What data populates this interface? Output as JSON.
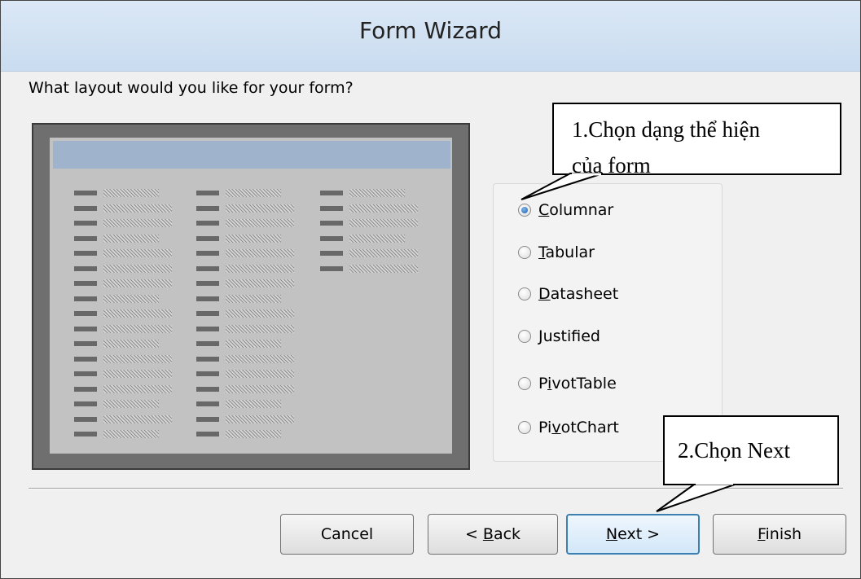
{
  "window": {
    "title": "Form Wizard"
  },
  "prompt": "What layout would you like for your form?",
  "layout_options": [
    {
      "accel": "C",
      "rest": "olumnar",
      "selected": true
    },
    {
      "accel": "T",
      "rest": "abular",
      "selected": false
    },
    {
      "accel": "D",
      "rest": "atasheet",
      "selected": false
    },
    {
      "accel": "J",
      "rest": "ustified",
      "selected": false
    },
    {
      "pre": "P",
      "accel": "i",
      "rest": "votTable",
      "selected": false
    },
    {
      "pre": "Pi",
      "accel": "v",
      "rest": "otChart",
      "selected": false
    }
  ],
  "buttons": {
    "cancel": {
      "label": "Cancel"
    },
    "back": {
      "pre": "< ",
      "accel": "B",
      "rest": "ack"
    },
    "next": {
      "accel": "N",
      "rest": "ext >"
    },
    "finish": {
      "accel": "F",
      "rest": "inish"
    }
  },
  "annotations": {
    "callout1_line1": "1.Chọn dạng thể hiện",
    "callout1_line2": "của form",
    "callout2": "2.Chọn Next"
  },
  "colors": {
    "titlebar": "#d3e3f4",
    "preview_header": "#9fb4cc",
    "selected_radio": "#1d5fae",
    "default_button_border": "#3c7fb1"
  }
}
